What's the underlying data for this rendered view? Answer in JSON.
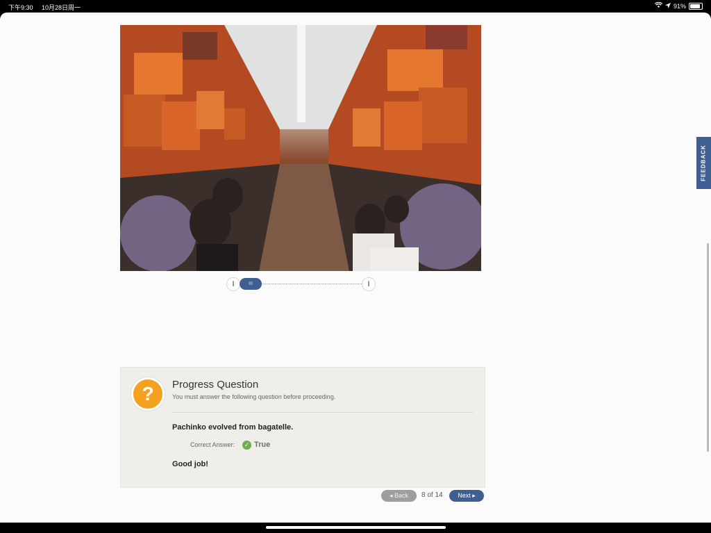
{
  "status_bar": {
    "time": "下午9:30",
    "date": "10月28日周一",
    "battery": "91%"
  },
  "slider": {
    "handle_label": "III",
    "start_label": "I",
    "end_label": "I"
  },
  "question": {
    "title": "Progress Question",
    "subtitle": "You must answer the following question before proceeding.",
    "statement": "Pachinko evolved from bagatelle.",
    "correct_answer_label": "Correct Answer:",
    "correct_answer_value": "True",
    "feedback": "Good job!",
    "icon": "?"
  },
  "navigation": {
    "back_label": "Back",
    "page_indicator": "8 of 14",
    "next_label": "Next"
  },
  "feedback_tab": {
    "label": "FEEDBACK"
  },
  "colors": {
    "accent": "#3f5f93",
    "question_icon": "#f3a11e",
    "check": "#6dac4f"
  }
}
